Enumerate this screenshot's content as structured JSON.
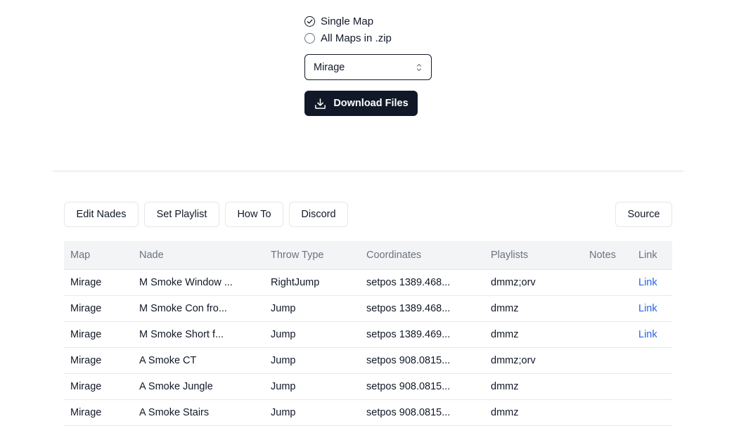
{
  "options": {
    "single_map": "Single Map",
    "all_maps": "All Maps in .zip",
    "selected": "single_map"
  },
  "map_select": {
    "value": "Mirage"
  },
  "download": {
    "label": "Download Files"
  },
  "nav": {
    "edit_nades": "Edit Nades",
    "set_playlist": "Set Playlist",
    "how_to": "How To",
    "discord": "Discord",
    "source": "Source"
  },
  "table": {
    "headers": [
      "Map",
      "Nade",
      "Throw Type",
      "Coordinates",
      "Playlists",
      "Notes",
      "Link"
    ],
    "rows": [
      {
        "map": "Mirage",
        "nade": "M Smoke Window ...",
        "throw": "RightJump",
        "coords": "setpos 1389.468...",
        "playlists": "dmmz;orv",
        "notes": "",
        "link": "Link"
      },
      {
        "map": "Mirage",
        "nade": "M Smoke Con fro...",
        "throw": "Jump",
        "coords": "setpos 1389.468...",
        "playlists": "dmmz",
        "notes": "",
        "link": "Link"
      },
      {
        "map": "Mirage",
        "nade": "M Smoke Short f...",
        "throw": "Jump",
        "coords": "setpos 1389.469...",
        "playlists": "dmmz",
        "notes": "",
        "link": "Link"
      },
      {
        "map": "Mirage",
        "nade": "A Smoke CT",
        "throw": "Jump",
        "coords": "setpos 908.0815...",
        "playlists": "dmmz;orv",
        "notes": "",
        "link": ""
      },
      {
        "map": "Mirage",
        "nade": "A Smoke Jungle",
        "throw": "Jump",
        "coords": "setpos 908.0815...",
        "playlists": "dmmz",
        "notes": "",
        "link": ""
      },
      {
        "map": "Mirage",
        "nade": "A Smoke Stairs",
        "throw": "Jump",
        "coords": "setpos 908.0815...",
        "playlists": "dmmz",
        "notes": "",
        "link": ""
      }
    ]
  },
  "colors": {
    "primary": "#111827",
    "link": "#2563eb",
    "header_bg": "#f3f4f6",
    "border": "#e5e7eb"
  },
  "icons": {
    "selected_radio": "check-circle-icon",
    "select": "chevron-up-down-icon",
    "download": "download-icon"
  }
}
